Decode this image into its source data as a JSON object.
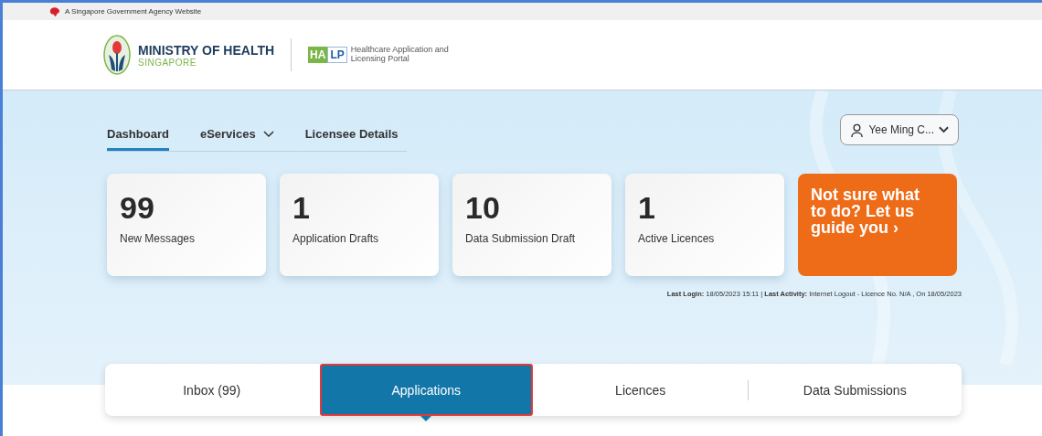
{
  "gov_bar": {
    "text": "A Singapore Government Agency Website"
  },
  "header": {
    "ministry": "MINISTRY OF HEALTH",
    "country": "SINGAPORE",
    "portal_badge_left": "HA",
    "portal_badge_right": "LP",
    "portal_name": "Healthcare Application and Licensing Portal"
  },
  "nav": [
    {
      "label": "Dashboard",
      "selected": true,
      "dropdown": false
    },
    {
      "label": "eServices",
      "selected": false,
      "dropdown": true
    },
    {
      "label": "Licensee Details",
      "selected": false,
      "dropdown": false
    }
  ],
  "user_menu": {
    "label": "Yee Ming C..."
  },
  "stats": [
    {
      "count": "99",
      "label": "New Messages"
    },
    {
      "count": "1",
      "label": "Application Drafts"
    },
    {
      "count": "10",
      "label": "Data Submission Draft"
    },
    {
      "count": "1",
      "label": "Active Licences"
    }
  ],
  "guide": {
    "text": "Not sure what to do? Let us guide you ›"
  },
  "last_activity": "**Last Login:** 18/05/2023 15:11 | **Last Activity:** Internet Logout - Licence No. N/A , On 18/05/2023",
  "tabs": [
    {
      "label": "Inbox (99)",
      "selected": false
    },
    {
      "label": "Applications",
      "selected": true
    },
    {
      "label": "Licences",
      "selected": false
    },
    {
      "label": "Data Submissions",
      "selected": false
    }
  ]
}
